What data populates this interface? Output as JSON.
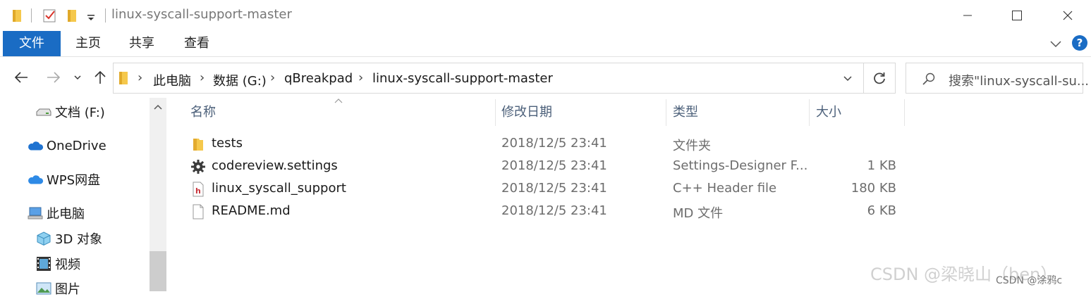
{
  "window": {
    "title": "linux-syscall-support-master"
  },
  "ribbon": {
    "tabs": [
      "文件",
      "主页",
      "共享",
      "查看"
    ],
    "help": "?"
  },
  "address": {
    "crumbs": [
      "此电脑",
      "数据 (G:)",
      "qBreakpad",
      "linux-syscall-support-master"
    ]
  },
  "search": {
    "placeholder": "搜索\"linux-syscall-su..."
  },
  "navpane": {
    "items": [
      {
        "label": "文档 (F:)",
        "icon": "drive-icon"
      },
      {
        "label": "OneDrive",
        "icon": "cloud-icon"
      },
      {
        "label": "WPS网盘",
        "icon": "cloud-icon"
      },
      {
        "label": "此电脑",
        "icon": "computer-icon"
      },
      {
        "label": "3D 对象",
        "icon": "cube-icon"
      },
      {
        "label": "视频",
        "icon": "film-icon"
      },
      {
        "label": "图片",
        "icon": "picture-icon"
      }
    ]
  },
  "filelist": {
    "headers": {
      "name": "名称",
      "modified": "修改日期",
      "type": "类型",
      "size": "大小"
    },
    "rows": [
      {
        "name": "tests",
        "modified": "2018/12/5 23:41",
        "type": "文件夹",
        "size": "",
        "icon": "folder-icon"
      },
      {
        "name": "codereview.settings",
        "modified": "2018/12/5 23:41",
        "type": "Settings-Designer F...",
        "size": "1 KB",
        "icon": "gear-icon"
      },
      {
        "name": "linux_syscall_support",
        "modified": "2018/12/5 23:41",
        "type": "C++ Header file",
        "size": "180 KB",
        "icon": "header-file-icon"
      },
      {
        "name": "README.md",
        "modified": "2018/12/5 23:41",
        "type": "MD 文件",
        "size": "6 KB",
        "icon": "file-icon"
      }
    ]
  },
  "watermark": {
    "text": "CSDN @梁晓山（ben）",
    "text2": "CSDN @涂鸦c"
  },
  "colors": {
    "accent": "#1a6cc4",
    "folder": "#f5c84c"
  }
}
